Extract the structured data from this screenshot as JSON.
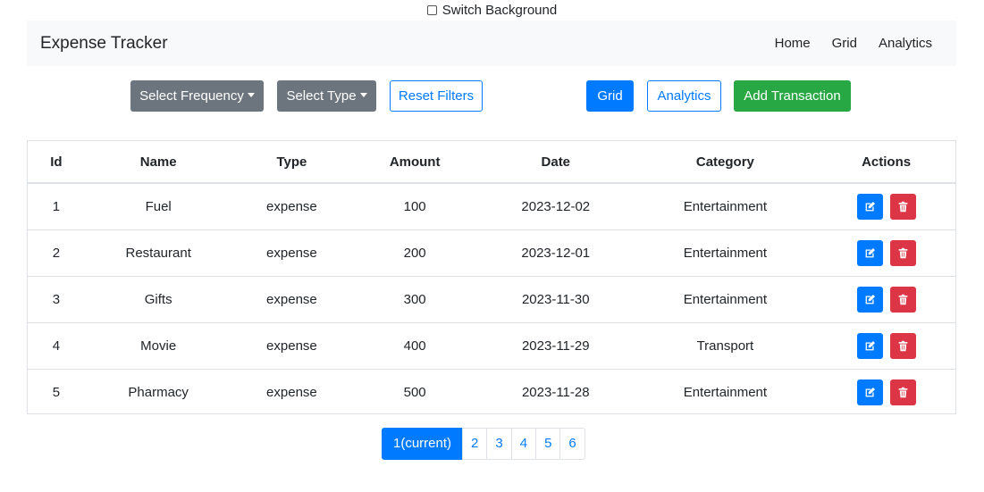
{
  "switch": {
    "label": "Switch Background",
    "checked": false
  },
  "navbar": {
    "brand": "Expense Tracker",
    "links": [
      "Home",
      "Grid",
      "Analytics"
    ]
  },
  "toolbar": {
    "frequency": "Select Frequency",
    "type": "Select Type",
    "reset": "Reset Filters",
    "grid": "Grid",
    "analytics": "Analytics",
    "add": "Add Transaction"
  },
  "table": {
    "headers": [
      "Id",
      "Name",
      "Type",
      "Amount",
      "Date",
      "Category",
      "Actions"
    ],
    "rows": [
      [
        "1",
        "Fuel",
        "expense",
        "100",
        "2023-12-02",
        "Entertainment"
      ],
      [
        "2",
        "Restaurant",
        "expense",
        "200",
        "2023-12-01",
        "Entertainment"
      ],
      [
        "3",
        "Gifts",
        "expense",
        "300",
        "2023-11-30",
        "Entertainment"
      ],
      [
        "4",
        "Movie",
        "expense",
        "400",
        "2023-11-29",
        "Transport"
      ],
      [
        "5",
        "Pharmacy",
        "expense",
        "500",
        "2023-11-28",
        "Entertainment"
      ]
    ]
  },
  "pagination": {
    "current": "1(current)",
    "pages": [
      "2",
      "3",
      "4",
      "5",
      "6"
    ]
  },
  "colors": {
    "primary": "#007bff",
    "secondary": "#6c757d",
    "success": "#28a745",
    "danger": "#dc3545",
    "navbar_bg": "#f8f9fa"
  },
  "icons": {
    "edit": "edit-icon",
    "delete": "trash-icon"
  }
}
